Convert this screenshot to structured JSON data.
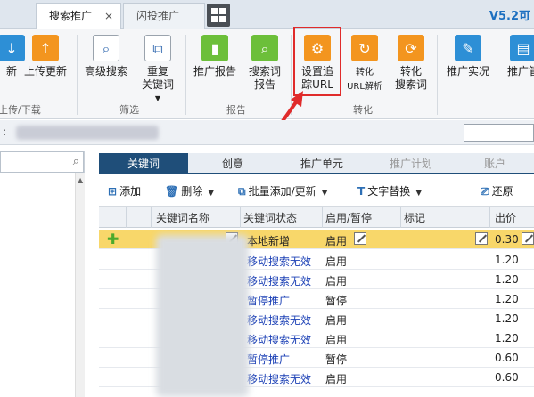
{
  "tabs": [
    {
      "label": "搜索推广",
      "close": "×"
    },
    {
      "label": "闪投推广"
    }
  ],
  "version": "V5.2可",
  "ribbon": {
    "buttons": [
      {
        "label": "新",
        "icon": "download-icon"
      },
      {
        "label": "上传更新",
        "icon": "upload-icon"
      },
      {
        "label": "高级搜索",
        "icon": "magnifier-icon"
      },
      {
        "label": "重复\n关键词",
        "icon": "duplicate-icon"
      },
      {
        "label": "推广报告",
        "icon": "chart-report-icon"
      },
      {
        "label": "搜索词\n报告",
        "icon": "search-report-icon"
      },
      {
        "label": "设置追\n踪URL",
        "icon": "gear-icon"
      },
      {
        "label": "转化\nURL解析",
        "icon": "refresh-icon"
      },
      {
        "label": "转化\n搜索词",
        "icon": "convert-search-icon"
      },
      {
        "label": "推广实况",
        "icon": "live-icon"
      },
      {
        "label": "推广管",
        "icon": "manage-icon"
      }
    ],
    "groups": [
      "上传/下载",
      "筛选",
      "报告",
      "转化"
    ]
  },
  "address": {
    "colon": ":"
  },
  "subtabs": [
    "关键词",
    "创意",
    "推广单元",
    "推广计划",
    "账户"
  ],
  "toolbar": {
    "add": "添加",
    "delete": "删除",
    "batch": "批量添加/更新",
    "replace": "文字替换",
    "restore": "还原"
  },
  "table": {
    "headers": [
      "关键词名称",
      "关键词状态",
      "启用/暂停",
      "标记",
      "出价"
    ],
    "rows": [
      {
        "status": "本地新增",
        "enabled": "启用",
        "price": "0.30"
      },
      {
        "status": "移动搜索无效",
        "enabled": "启用",
        "price": "1.20"
      },
      {
        "status": "移动搜索无效",
        "enabled": "启用",
        "price": "1.20"
      },
      {
        "status": "暂停推广",
        "enabled": "暂停",
        "price": "1.20"
      },
      {
        "status": "移动搜索无效",
        "enabled": "启用",
        "price": "1.20"
      },
      {
        "status": "移动搜索无效",
        "enabled": "启用",
        "price": "1.20"
      },
      {
        "status": "暂停推广",
        "enabled": "暂停",
        "price": "0.60"
      },
      {
        "status": "移动搜索无效",
        "enabled": "启用",
        "price": "0.60"
      }
    ]
  },
  "colors": {
    "highlight": "#e02b2b",
    "selected_row": "#f8d76a",
    "active_tab": "#1f4e79"
  }
}
